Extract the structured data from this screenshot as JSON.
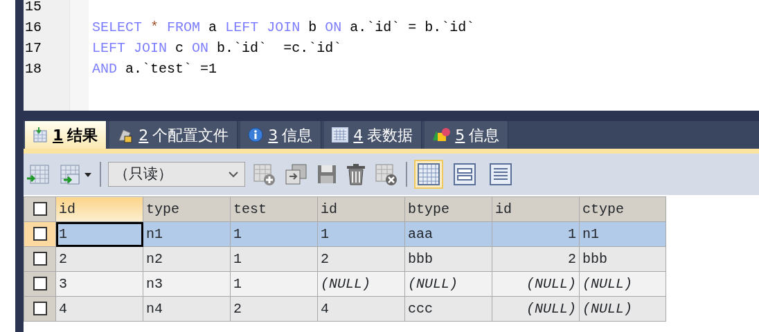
{
  "editor": {
    "lines": [
      {
        "number": "15"
      },
      {
        "number": "16",
        "segments": [
          {
            "text": "SELECT",
            "kind": "keyword"
          },
          {
            "text": "*",
            "kind": "operator"
          },
          {
            "text": "FROM",
            "kind": "keyword"
          },
          {
            "text": "a",
            "kind": "plain"
          },
          {
            "text": "LEFT JOIN",
            "kind": "keyword"
          },
          {
            "text": "b",
            "kind": "plain"
          },
          {
            "text": "ON",
            "kind": "keyword"
          },
          {
            "text": "a.`id` = b.`id`",
            "kind": "plain"
          }
        ]
      },
      {
        "number": "17",
        "segments": [
          {
            "text": "LEFT JOIN",
            "kind": "keyword"
          },
          {
            "text": "c",
            "kind": "plain"
          },
          {
            "text": "ON",
            "kind": "keyword"
          },
          {
            "text": "b.`id`  =c.`id`",
            "kind": "plain"
          }
        ]
      },
      {
        "number": "18",
        "segments": [
          {
            "text": "AND",
            "kind": "keyword"
          },
          {
            "text": "a.`test` =1",
            "kind": "plain"
          }
        ]
      }
    ]
  },
  "tabs": [
    {
      "hotkey": "1",
      "label": "结果",
      "selected": true
    },
    {
      "hotkey": "2",
      "label": "个配置文件",
      "selected": false
    },
    {
      "hotkey": "3",
      "label": "信息",
      "selected": false
    },
    {
      "hotkey": "4",
      "label": "表数据",
      "selected": false
    },
    {
      "hotkey": "5",
      "label": "信息",
      "selected": false
    }
  ],
  "toolbar": {
    "mode": "（只读）",
    "view_modes": [
      {
        "selected": true
      },
      {
        "selected": false
      },
      {
        "selected": false
      }
    ]
  },
  "table": {
    "all_checked": false,
    "columns": [
      {
        "label": "id",
        "kind": "text",
        "selected": true
      },
      {
        "label": "type",
        "kind": "text",
        "selected": false
      },
      {
        "label": "test",
        "kind": "text",
        "selected": false
      },
      {
        "label": "id",
        "kind": "text",
        "selected": false
      },
      {
        "label": "btype",
        "kind": "text",
        "selected": false
      },
      {
        "label": "id",
        "kind": "number",
        "selected": false
      },
      {
        "label": "ctype",
        "kind": "text",
        "selected": false
      }
    ],
    "rows": [
      {
        "selected": true,
        "checked": false,
        "cells": [
          {
            "text": "1",
            "is_null": false
          },
          {
            "text": "n1",
            "is_null": false
          },
          {
            "text": "1",
            "is_null": false
          },
          {
            "text": "1",
            "is_null": false
          },
          {
            "text": "aaa",
            "is_null": false
          },
          {
            "text": "1",
            "is_null": false
          },
          {
            "text": "n1",
            "is_null": false
          }
        ]
      },
      {
        "selected": false,
        "checked": false,
        "cells": [
          {
            "text": "2",
            "is_null": false
          },
          {
            "text": "n2",
            "is_null": false
          },
          {
            "text": "1",
            "is_null": false
          },
          {
            "text": "2",
            "is_null": false
          },
          {
            "text": "bbb",
            "is_null": false
          },
          {
            "text": "2",
            "is_null": false
          },
          {
            "text": "bbb",
            "is_null": false
          }
        ]
      },
      {
        "selected": false,
        "checked": false,
        "cells": [
          {
            "text": "3",
            "is_null": false
          },
          {
            "text": "n3",
            "is_null": false
          },
          {
            "text": "1",
            "is_null": false
          },
          {
            "text": "(NULL)",
            "is_null": true
          },
          {
            "text": "(NULL)",
            "is_null": true
          },
          {
            "text": "(NULL)",
            "is_null": true
          },
          {
            "text": "(NULL)",
            "is_null": true
          }
        ]
      },
      {
        "selected": false,
        "checked": false,
        "cells": [
          {
            "text": "4",
            "is_null": false
          },
          {
            "text": "n4",
            "is_null": false
          },
          {
            "text": "2",
            "is_null": false
          },
          {
            "text": "4",
            "is_null": false
          },
          {
            "text": "ccc",
            "is_null": false
          },
          {
            "text": "(NULL)",
            "is_null": true
          },
          {
            "text": "(NULL)",
            "is_null": true
          }
        ]
      }
    ]
  }
}
